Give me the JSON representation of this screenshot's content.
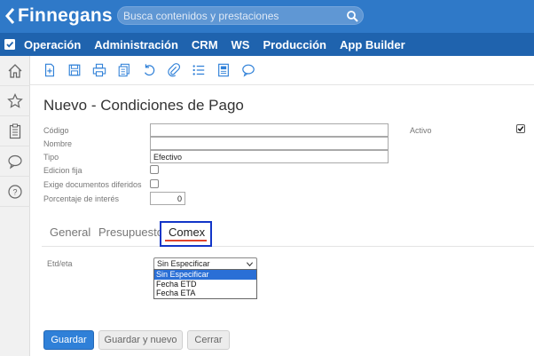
{
  "app": {
    "logo_text": "Finnegans",
    "search_placeholder": "Busca contenidos y prestaciones"
  },
  "nav": {
    "items": [
      "Operación",
      "Administración",
      "CRM",
      "WS",
      "Producción",
      "App Builder"
    ]
  },
  "form": {
    "title": "Nuevo - Condiciones de Pago",
    "fields": {
      "codigo_label": "Código",
      "nombre_label": "Nombre",
      "tipo_label": "Tipo",
      "tipo_value": "Efectivo",
      "edicion_fija_label": "Edicion fija",
      "exige_docs_label": "Exige documentos diferidos",
      "porcentaje_label": "Porcentaje de interés",
      "porcentaje_value": "0",
      "activo_label": "Activo",
      "activo_checked": true
    }
  },
  "tabs": {
    "general": "General",
    "presupuesto": "Presupuesto",
    "comex": "Comex",
    "active": "comex"
  },
  "comex": {
    "etd_label": "Etd/eta",
    "selected": "Sin Especificar",
    "options": [
      "Sin Especificar",
      "Fecha ETD",
      "Fecha ETA"
    ]
  },
  "buttons": {
    "guardar": "Guardar",
    "guardar_nuevo": "Guardar y nuevo",
    "cerrar": "Cerrar"
  },
  "colors": {
    "topbar": "#2f79c8",
    "navbar": "#1f63ae",
    "primary": "#2f80d8",
    "highlight_box": "#1236c8",
    "tab_underline": "#e0442f",
    "option_selected": "#2a6fd6"
  }
}
